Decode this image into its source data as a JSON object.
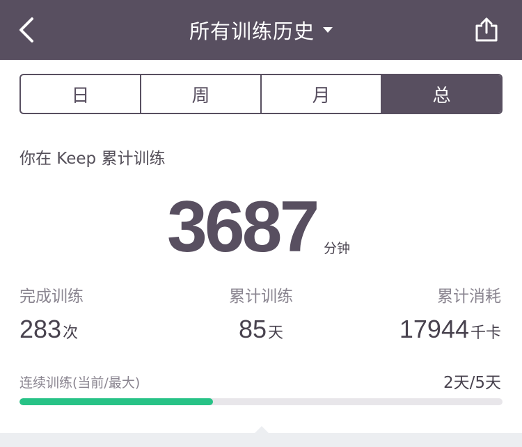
{
  "header": {
    "title": "所有训练历史",
    "back_icon": "chevron-left-icon",
    "share_icon": "share-icon",
    "bg_color": "#584f60"
  },
  "segments": {
    "items": [
      "日",
      "周",
      "月",
      "总"
    ],
    "selected": "总"
  },
  "summary": {
    "subtitle": "你在 Keep 累计训练",
    "total_value": "3687",
    "total_unit": "分钟"
  },
  "stats": [
    {
      "label": "完成训练",
      "value": "283",
      "unit": "次"
    },
    {
      "label": "累计训练",
      "value": "85",
      "unit": "天"
    },
    {
      "label": "累计消耗",
      "value": "17944",
      "unit": "千卡"
    }
  ],
  "streak": {
    "label": "连续训练(当前/最大)",
    "value": "2天/5天",
    "progress_fraction": 0.4,
    "bar_color": "#27c286"
  }
}
